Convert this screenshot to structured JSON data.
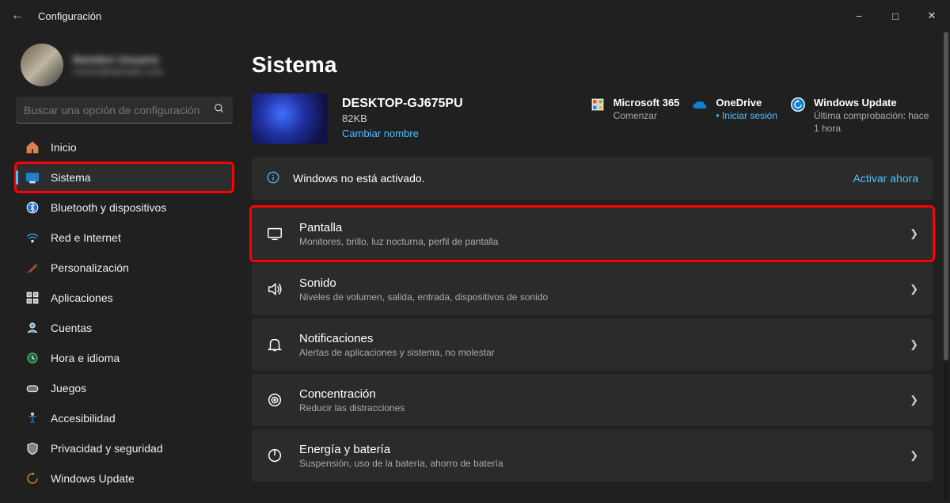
{
  "titlebar": {
    "app": "Configuración"
  },
  "search": {
    "placeholder": "Buscar una opción de configuración"
  },
  "sidebar": {
    "items": [
      {
        "label": "Inicio"
      },
      {
        "label": "Sistema"
      },
      {
        "label": "Bluetooth y dispositivos"
      },
      {
        "label": "Red e Internet"
      },
      {
        "label": "Personalización"
      },
      {
        "label": "Aplicaciones"
      },
      {
        "label": "Cuentas"
      },
      {
        "label": "Hora e idioma"
      },
      {
        "label": "Juegos"
      },
      {
        "label": "Accesibilidad"
      },
      {
        "label": "Privacidad y seguridad"
      },
      {
        "label": "Windows Update"
      }
    ]
  },
  "page": {
    "heading": "Sistema"
  },
  "device": {
    "name": "DESKTOP-GJ675PU",
    "size": "82KB",
    "rename": "Cambiar nombre"
  },
  "cloud": {
    "m365": {
      "title": "Microsoft 365",
      "sub": "Comenzar"
    },
    "onedrive": {
      "title": "OneDrive",
      "sub": "Iniciar sesión"
    },
    "update": {
      "title": "Windows Update",
      "sub": "Última comprobación: hace 1 hora"
    }
  },
  "banner": {
    "msg": "Windows no está activado.",
    "action": "Activar ahora"
  },
  "cards": [
    {
      "title": "Pantalla",
      "sub": "Monitores, brillo, luz nocturna, perfil de pantalla"
    },
    {
      "title": "Sonido",
      "sub": "Niveles de volumen, salida, entrada, dispositivos de sonido"
    },
    {
      "title": "Notificaciones",
      "sub": "Alertas de aplicaciones y sistema, no molestar"
    },
    {
      "title": "Concentración",
      "sub": "Reducir las distracciones"
    },
    {
      "title": "Energía y batería",
      "sub": "Suspensión, uso de la batería, ahorro de batería"
    }
  ]
}
